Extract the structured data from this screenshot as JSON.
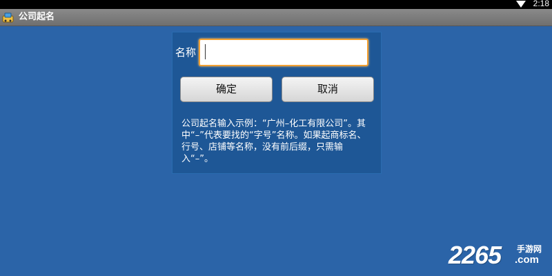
{
  "status_bar": {
    "time": "2:18",
    "wifi_icon": "wifi-icon"
  },
  "app": {
    "title": "公司起名",
    "icon": "app-icon"
  },
  "form": {
    "name_label": "名称",
    "name_value": "",
    "confirm_label": "确定",
    "cancel_label": "取消",
    "hint": "公司起名输入示例：“广州–化工有限公司”。其中“–”代表要找的“字号”名称。如果起商标名、行号、店铺等名称，没有前后缀，只需输入“–”。"
  },
  "watermark": {
    "number": "2265",
    "site_cn": "手游网",
    "domain": ".com"
  },
  "colors": {
    "background": "#2b64a8",
    "panel": "#1e5796",
    "input_focus_border": "#f2a032"
  }
}
